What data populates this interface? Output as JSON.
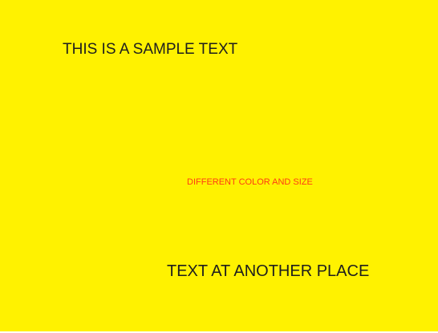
{
  "colors": {
    "background": "#fff200",
    "primary_text": "#1e1e1e",
    "accent_text": "#ff3b14"
  },
  "texts": {
    "sample": "THIS IS A SAMPLE TEXT",
    "different": "DIFFERENT COLOR AND SIZE",
    "another": "TEXT AT ANOTHER PLACE"
  }
}
